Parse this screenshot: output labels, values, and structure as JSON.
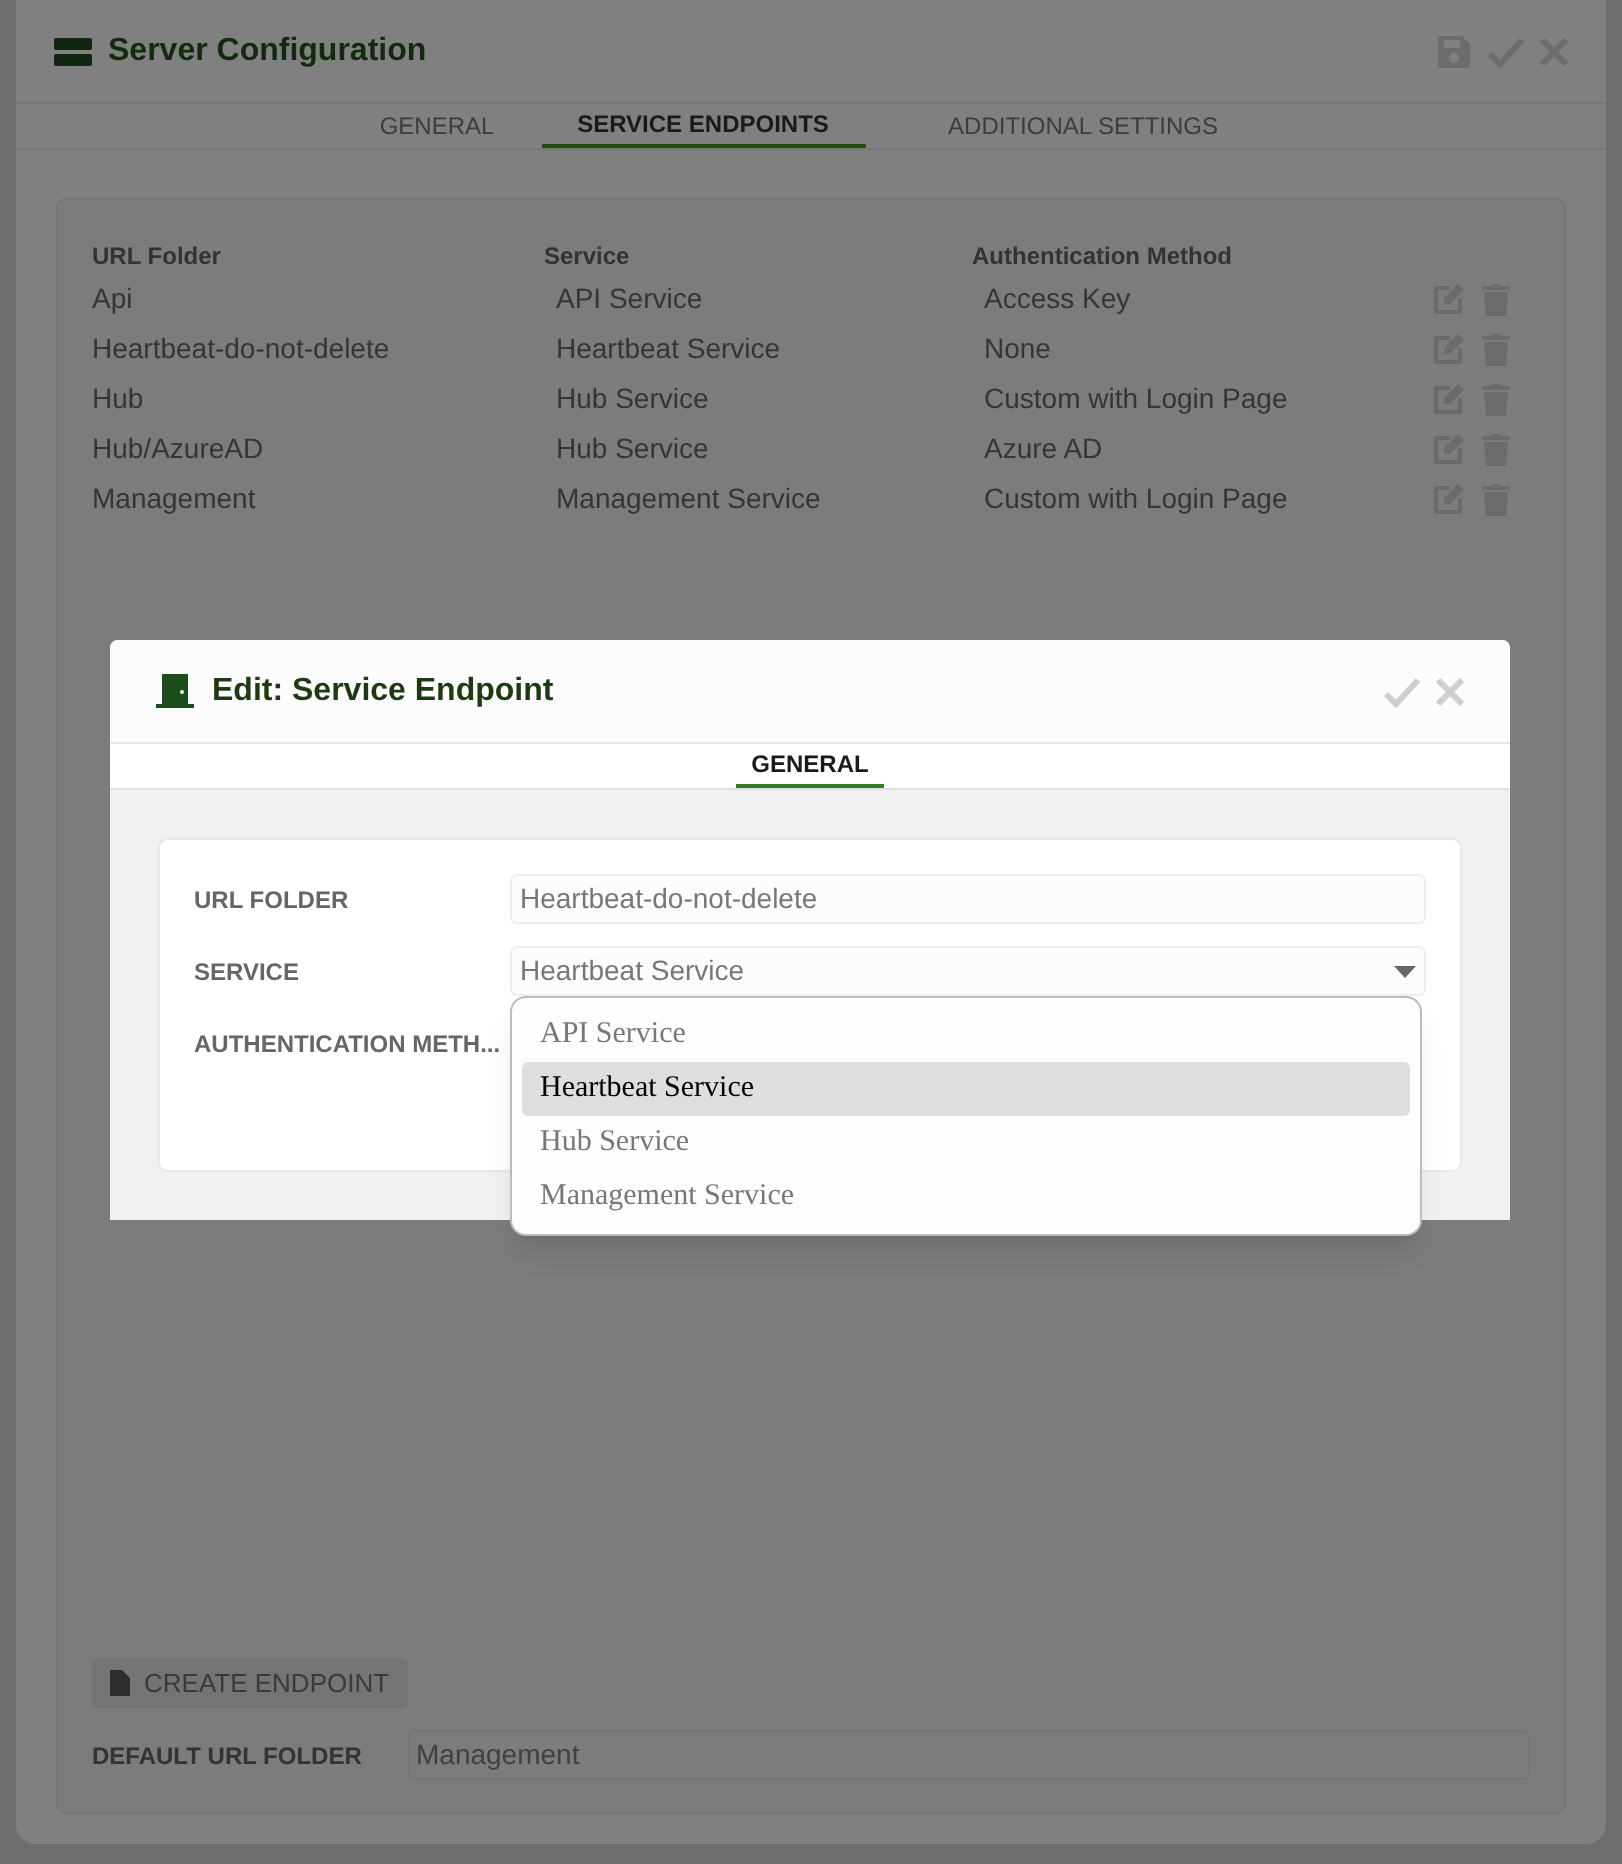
{
  "window": {
    "title": "Server Configuration"
  },
  "tabs": [
    {
      "label": "GENERAL",
      "selected": false
    },
    {
      "label": "SERVICE ENDPOINTS",
      "selected": true
    },
    {
      "label": "ADDITIONAL SETTINGS",
      "selected": false
    }
  ],
  "endpoints": {
    "columns": [
      "URL Folder",
      "Service",
      "Authentication Method"
    ],
    "rows": [
      [
        "Api",
        "API Service",
        "Access Key"
      ],
      [
        "Heartbeat-do-not-delete",
        "Heartbeat Service",
        "None"
      ],
      [
        "Hub",
        "Hub Service",
        "Custom with Login Page"
      ],
      [
        "Hub/AzureAD",
        "Hub Service",
        "Azure AD"
      ],
      [
        "Management",
        "Management Service",
        "Custom with Login Page"
      ]
    ]
  },
  "create_button": "CREATE ENDPOINT",
  "default_url_folder": {
    "label": "DEFAULT URL FOLDER",
    "value": "Management"
  },
  "dialog": {
    "title": "Edit: Service Endpoint",
    "tabs": [
      {
        "label": "GENERAL",
        "selected": true
      }
    ],
    "fields": [
      {
        "kind": "text",
        "label": "URL FOLDER",
        "value": "Heartbeat-do-not-delete"
      },
      {
        "kind": "select",
        "label": "SERVICE",
        "value": "Heartbeat Service"
      },
      {
        "kind": "hidden",
        "label": "AUTHENTICATION METH..."
      }
    ],
    "dropdown": [
      {
        "label": "API Service",
        "selected": false
      },
      {
        "label": "Heartbeat Service",
        "selected": true
      },
      {
        "label": "Hub Service",
        "selected": false
      },
      {
        "label": "Management Service",
        "selected": false
      }
    ]
  }
}
